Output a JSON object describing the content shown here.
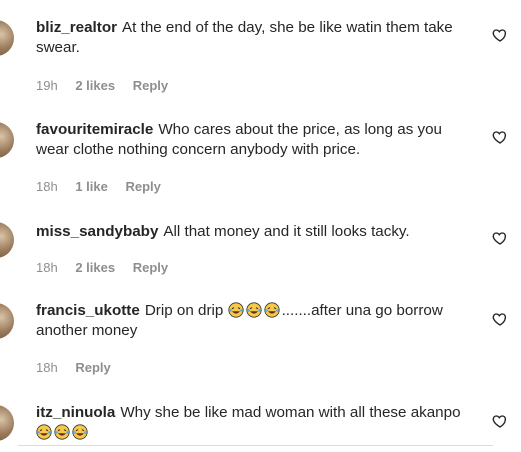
{
  "comments": [
    {
      "username": "bliz_realtor",
      "text": "At the end of the day, she be like watin them take swear.",
      "time": "19h",
      "likes": "2 likes",
      "reply": "Reply"
    },
    {
      "username": "favouritemiracle",
      "text": "Who cares about the price, as long as you wear clothe nothing concern anybody with price.",
      "time": "18h",
      "likes": "1 like",
      "reply": "Reply"
    },
    {
      "username": "miss_sandybaby",
      "text": "All that money and it still looks tacky.",
      "time": "18h",
      "likes": "2 likes",
      "reply": "Reply"
    },
    {
      "username": "francis_ukotte",
      "text": "Drip on drip",
      "text_after": ".......after una go borrow another money",
      "time": "18h",
      "reply": "Reply"
    },
    {
      "username": "itz_ninuola",
      "text": "Why she be like mad woman with all these akanpo",
      "emoji_line": true
    }
  ],
  "icons": {
    "like": "heart-outline-icon",
    "emoji": "laughing-tears-emoji"
  }
}
